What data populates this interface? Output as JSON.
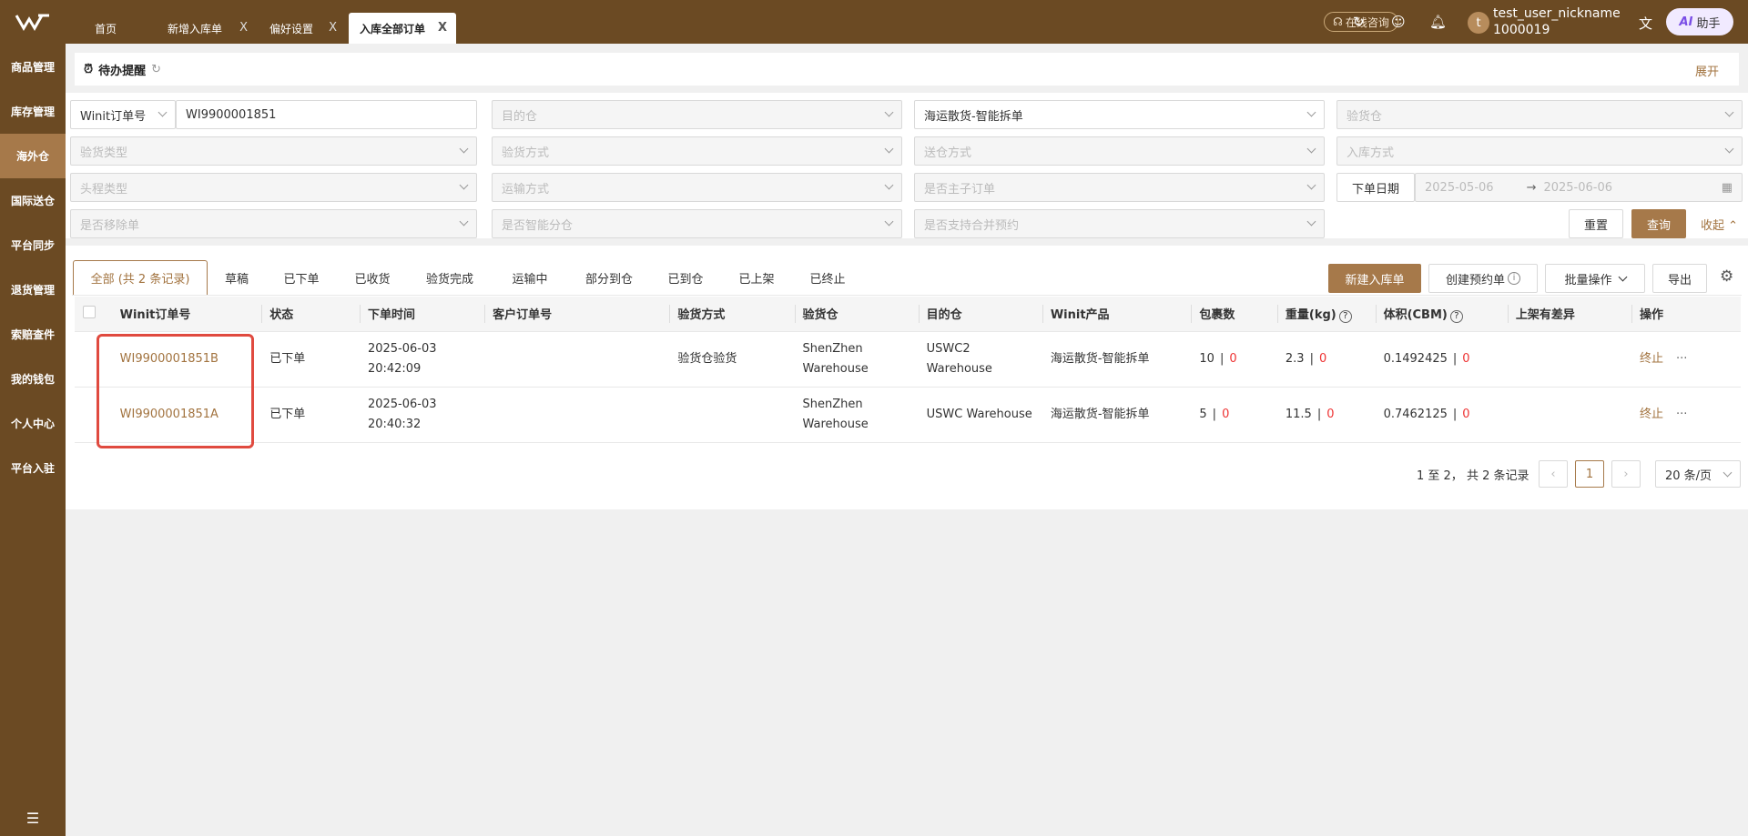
{
  "sidebar": {
    "items": [
      "商品管理",
      "库存管理",
      "海外仓",
      "国际送仓",
      "平台同步",
      "退货管理",
      "索赔查件",
      "我的钱包",
      "个人中心",
      "平台入驻"
    ],
    "active_index": 2
  },
  "topbar": {
    "tabs": [
      {
        "label": "首页",
        "closable": false
      },
      {
        "label": "新增入库单",
        "closable": true
      },
      {
        "label": "偏好设置",
        "closable": true
      },
      {
        "label": "入库全部订单",
        "closable": true,
        "active": true
      }
    ],
    "consult_label": "在线咨询",
    "avatar_letter": "t",
    "user_name": "test_user_nickname",
    "user_id": "1000019",
    "ai_label": "AI",
    "assistant_label": "助手",
    "close_glyph": "X"
  },
  "reminder": {
    "title": "待办提醒",
    "expand": "展开"
  },
  "filters": {
    "order_type_select": "Winit订单号",
    "order_no_value": "WI9900001851",
    "dest_warehouse": "目的仓",
    "product": "海运散货-智能拆单",
    "inspect_warehouse": "验货仓",
    "inspect_type": "验货类型",
    "inspect_method": "验货方式",
    "delivery_method": "送仓方式",
    "inbound_method": "入库方式",
    "first_leg_type": "头程类型",
    "transport_method": "运输方式",
    "is_master_sub": "是否主子订单",
    "order_date_label": "下单日期",
    "date_from": "2025-05-06",
    "date_arrow": "→",
    "date_to": "2025-06-06",
    "is_transfer": "是否移除单",
    "is_smart_split": "是否智能分仓",
    "merge_reserve": "是否支持合并预约",
    "reset": "重置",
    "query": "查询",
    "collapse": "收起"
  },
  "status_tabs": [
    "全部 (共 2 条记录)",
    "草稿",
    "已下单",
    "已收货",
    "验货完成",
    "运输中",
    "部分到仓",
    "已到仓",
    "已上架",
    "已终止"
  ],
  "actions": {
    "new_inbound": "新建入库单",
    "create_reserve": "创建预约单",
    "batch_ops": "批量操作",
    "export": "导出"
  },
  "table": {
    "headers": [
      "Winit订单号",
      "状态",
      "下单时间",
      "客户订单号",
      "验货方式",
      "验货仓",
      "目的仓",
      "Winit产品",
      "包裹数",
      "重量(kg)",
      "体积(CBM)",
      "上架有差异",
      "操作"
    ],
    "rows": [
      {
        "order_no": "WI9900001851B",
        "status": "已下单",
        "date": "2025-06-03",
        "time": "20:42:09",
        "customer_no": "",
        "inspect_method": "验货仓验货",
        "inspect_wh_1": "ShenZhen",
        "inspect_wh_2": "Warehouse",
        "dest_1": "USWC2",
        "dest_2": "Warehouse",
        "product": "海运散货-智能拆单",
        "pkg": "10",
        "pkg_diff": "0",
        "weight": "2.3",
        "weight_diff": "0",
        "volume": "0.1492425",
        "volume_diff": "0",
        "diff": "",
        "op": "终止",
        "more": "···"
      },
      {
        "order_no": "WI9900001851A",
        "status": "已下单",
        "date": "2025-06-03",
        "time": "20:40:32",
        "customer_no": "",
        "inspect_method": "",
        "inspect_wh_1": "ShenZhen",
        "inspect_wh_2": "Warehouse",
        "dest_1": "USWC Warehouse",
        "dest_2": "",
        "product": "海运散货-智能拆单",
        "pkg": "5",
        "pkg_diff": "0",
        "weight": "11.5",
        "weight_diff": "0",
        "volume": "0.7462125",
        "volume_diff": "0",
        "diff": "",
        "op": "终止",
        "more": "···"
      }
    ],
    "divider": "|"
  },
  "pagination": {
    "summary": "1 至 2， 共 2 条记录",
    "current": "1",
    "page_size": "20 条/页"
  },
  "colors": {
    "brand": "#6b4a23",
    "accent": "#a6794a",
    "highlight": "#e04a3f",
    "diff": "#e33333"
  }
}
